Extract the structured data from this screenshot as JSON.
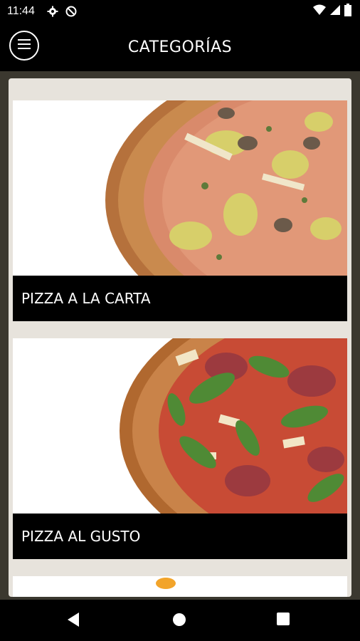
{
  "status_bar": {
    "time": "11:44",
    "icons": [
      "gear-icon",
      "no-sync-icon",
      "wifi-icon",
      "signal-icon",
      "battery-icon"
    ]
  },
  "app_bar": {
    "title": "CATEGORÍAS",
    "menu_icon": "menu-icon"
  },
  "categories": [
    {
      "label": "PIZZA A LA CARTA"
    },
    {
      "label": "PIZZA AL GUSTO"
    }
  ],
  "nav_bar": {
    "icons": [
      "back-triangle-icon",
      "home-circle-icon",
      "recents-square-icon"
    ]
  },
  "colors": {
    "bar_bg": "#000000",
    "content_bg": "#3b382f",
    "panel_bg": "#e7e3dc",
    "label_bar_bg": "#000000",
    "text": "#ffffff"
  }
}
